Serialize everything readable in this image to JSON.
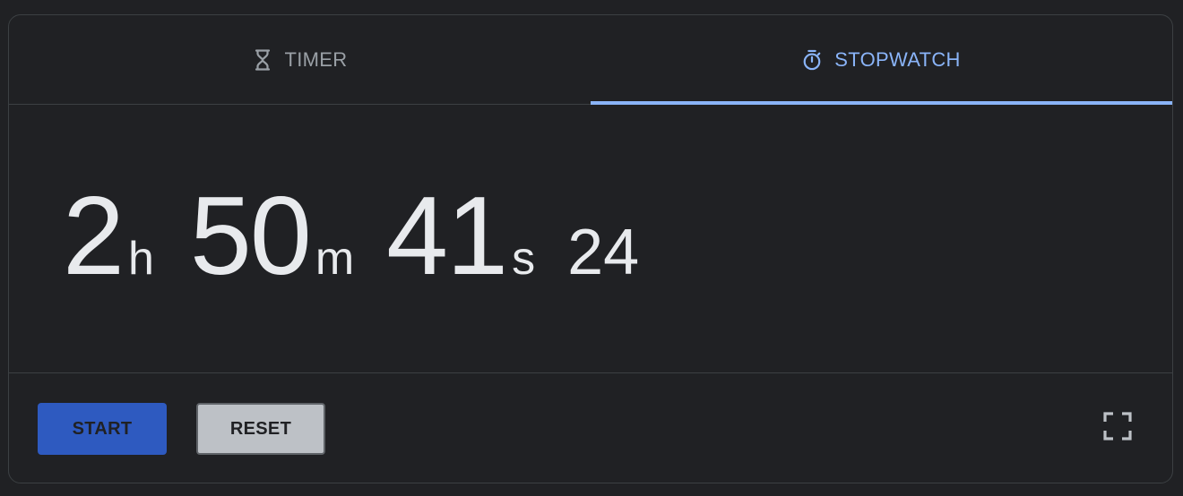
{
  "tabs": {
    "timer": {
      "label": "TIMER",
      "icon": "hourglass-icon"
    },
    "stopwatch": {
      "label": "STOPWATCH",
      "icon": "stopwatch-icon",
      "active": true
    }
  },
  "display": {
    "hours": "2",
    "hours_unit": "h",
    "minutes": "50",
    "minutes_unit": "m",
    "seconds": "41",
    "seconds_unit": "s",
    "centiseconds": "24"
  },
  "controls": {
    "start_label": "START",
    "reset_label": "RESET",
    "fullscreen_icon": "fullscreen-icon"
  },
  "colors": {
    "background": "#202124",
    "accent": "#8ab4f8",
    "start_button": "#2e5ac0",
    "reset_button": "#bdc1c6",
    "text_primary": "#e8eaed",
    "text_muted": "#9aa0a6"
  }
}
